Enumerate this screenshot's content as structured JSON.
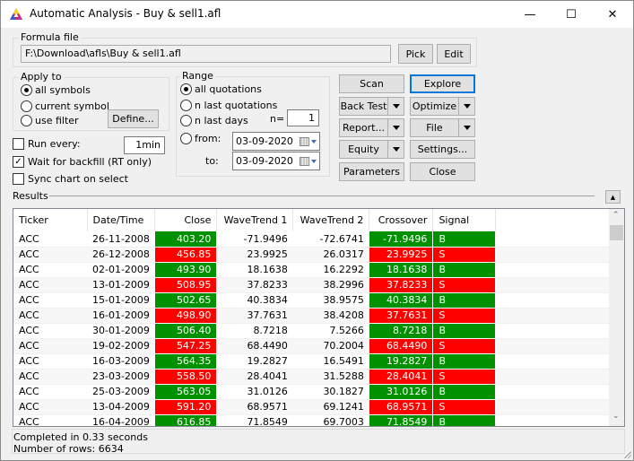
{
  "window": {
    "title": "Automatic Analysis - Buy & sell1.afl",
    "controls": {
      "minimize": "—",
      "maximize": "☐",
      "close": "✕"
    }
  },
  "formula": {
    "label": "Formula file",
    "path": "F:\\Download\\afls\\Buy & sell1.afl",
    "pick_label": "Pick",
    "edit_label": "Edit"
  },
  "apply_to": {
    "label": "Apply to",
    "options": [
      {
        "label": "all symbols",
        "selected": true
      },
      {
        "label": "current symbol",
        "selected": false
      },
      {
        "label": "use filter",
        "selected": false
      }
    ],
    "define_label": "Define..."
  },
  "range": {
    "label": "Range",
    "options": [
      {
        "label": "all quotations",
        "selected": true
      },
      {
        "label": "n last quotations",
        "selected": false
      },
      {
        "label": "n last days",
        "selected": false
      },
      {
        "label": "from:",
        "selected": false
      }
    ],
    "n_label": "n=",
    "n_value": "1",
    "to_label": "to:",
    "from_date": "03-09-2020",
    "to_date": "03-09-2020"
  },
  "options": {
    "run_every": {
      "label": "Run every:",
      "checked": false,
      "value": "1min"
    },
    "wait_backfill": {
      "label": "Wait for backfill (RT only)",
      "checked": true
    },
    "sync_chart": {
      "label": "Sync chart on select",
      "checked": false
    }
  },
  "actions": {
    "scan": "Scan",
    "explore": "Explore",
    "back_test": "Back Test",
    "optimize": "Optimize",
    "report": "Report...",
    "file": "File",
    "equity": "Equity",
    "settings": "Settings...",
    "parameters": "Parameters",
    "close": "Close"
  },
  "results": {
    "label": "Results",
    "columns": [
      "Ticker",
      "Date/Time",
      "Close",
      "WaveTrend 1",
      "WaveTrend 2",
      "Crossover",
      "Signal"
    ],
    "colors": {
      "buy": "#009000",
      "sell": "#ff0000"
    },
    "rows": [
      [
        "ACC",
        "26-11-2008",
        "403.20",
        "-71.9496",
        "-72.6741",
        "-71.9496",
        "B"
      ],
      [
        "ACC",
        "26-12-2008",
        "456.85",
        "23.9925",
        "26.0317",
        "23.9925",
        "S"
      ],
      [
        "ACC",
        "02-01-2009",
        "493.90",
        "18.1638",
        "16.2292",
        "18.1638",
        "B"
      ],
      [
        "ACC",
        "13-01-2009",
        "508.95",
        "37.8233",
        "38.2996",
        "37.8233",
        "S"
      ],
      [
        "ACC",
        "15-01-2009",
        "502.65",
        "40.3834",
        "38.9575",
        "40.3834",
        "B"
      ],
      [
        "ACC",
        "16-01-2009",
        "498.90",
        "37.7631",
        "38.4208",
        "37.7631",
        "S"
      ],
      [
        "ACC",
        "30-01-2009",
        "506.40",
        "8.7218",
        "7.5266",
        "8.7218",
        "B"
      ],
      [
        "ACC",
        "19-02-2009",
        "547.25",
        "68.4490",
        "70.2004",
        "68.4490",
        "S"
      ],
      [
        "ACC",
        "16-03-2009",
        "564.35",
        "19.2827",
        "16.5491",
        "19.2827",
        "B"
      ],
      [
        "ACC",
        "23-03-2009",
        "558.50",
        "28.4041",
        "31.5288",
        "28.4041",
        "S"
      ],
      [
        "ACC",
        "25-03-2009",
        "563.05",
        "31.0126",
        "30.1827",
        "31.0126",
        "B"
      ],
      [
        "ACC",
        "13-04-2009",
        "591.20",
        "68.9571",
        "69.1241",
        "68.9571",
        "S"
      ],
      [
        "ACC",
        "16-04-2009",
        "616.85",
        "71.8549",
        "69.7003",
        "71.8549",
        "B"
      ]
    ]
  },
  "status": {
    "line1": "Completed in 0.33 seconds",
    "line2": "Number of rows: 6634"
  }
}
